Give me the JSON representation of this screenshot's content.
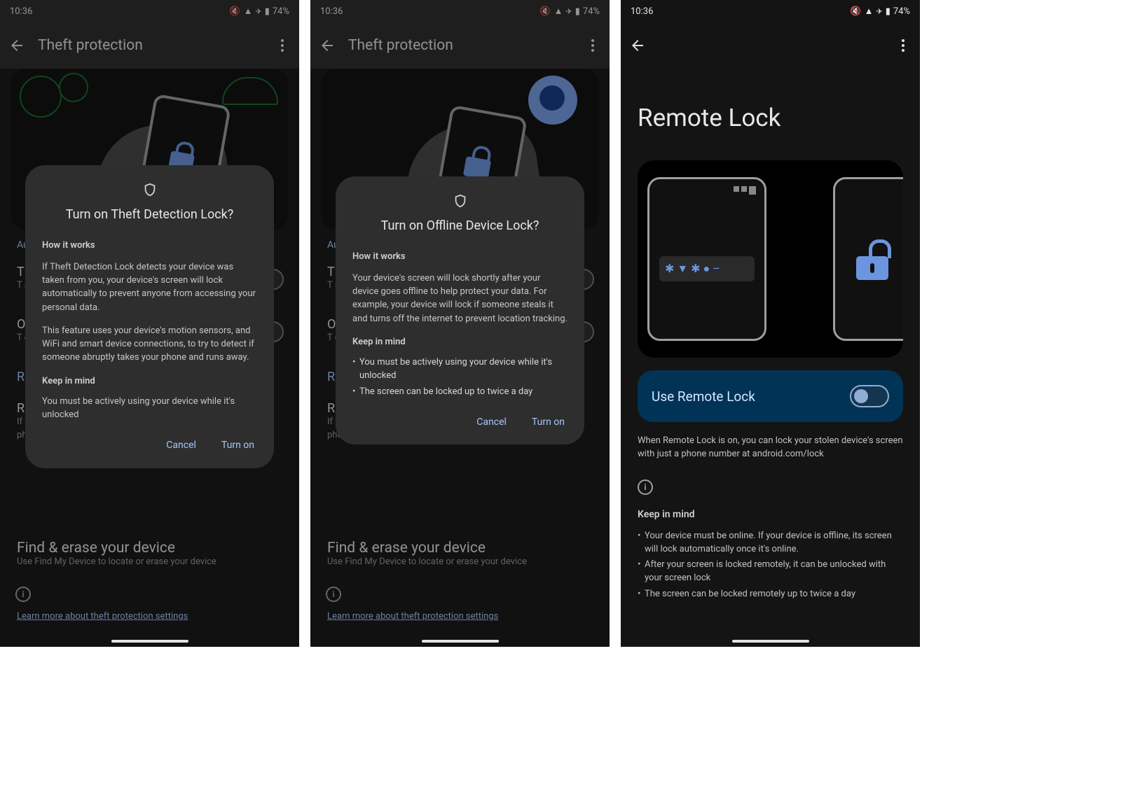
{
  "statusbar": {
    "time": "10:36",
    "battery": "74%"
  },
  "phone1": {
    "toolbar_title": "Theft protection",
    "bg_link": "Au",
    "row_t_title": "T",
    "row_t_sub": "T\nsc",
    "row_o_title": "O",
    "row_o_sub": "T\nof",
    "row_r_title": "R",
    "row_r2": "R",
    "row_r2_sub": "If y\npho",
    "find_title": "Find & erase your device",
    "find_sub": "Use Find My Device to locate or erase your device",
    "learn": "Learn more about theft protection settings",
    "dialog": {
      "title": "Turn on Theft Detection Lock?",
      "how": "How it works",
      "p1": "If Theft Detection Lock detects your device was taken from you, your device's screen will lock automatically to prevent anyone from accessing your personal data.",
      "p2": "This feature uses your device's motion sensors, and WiFi and smart device connections, to try to detect if someone abruptly takes your phone and runs away.",
      "keep": "Keep in mind",
      "k1": "You must be actively using your device while it's unlocked",
      "cancel": "Cancel",
      "turnon": "Turn on"
    }
  },
  "phone2": {
    "toolbar_title": "Theft protection",
    "bg_link": "Au",
    "row_t_title": "T",
    "row_t_sub": "T\nsc",
    "row_o_title": "O",
    "row_o_sub": "T\nof",
    "row_r_title": "R",
    "row_r2": "R",
    "row_r2_sub": "If y                                                                     a\nphone number",
    "find_title": "Find & erase your device",
    "find_sub": "Use Find My Device to locate or erase your device",
    "learn": "Learn more about theft protection settings",
    "dialog": {
      "title": "Turn on Offline Device Lock?",
      "how": "How it works",
      "p1": "Your device's screen will lock shortly after your device goes offline to help protect your data. For example, your device will lock if someone steals it and turns off the internet to prevent location tracking.",
      "keep": "Keep in mind",
      "b1": "You must be actively using your device while it's unlocked",
      "b2": "The screen can be locked up to twice a day",
      "cancel": "Cancel",
      "turnon": "Turn on"
    }
  },
  "phone3": {
    "title": "Remote Lock",
    "toggle_label": "Use Remote Lock",
    "desc": "When Remote Lock is on, you can lock your stolen device's screen with just a phone number at android.com/lock",
    "keep": "Keep in mind",
    "b1": "Your device must be online. If your device is offline, its screen will lock automatically once it's online.",
    "b2": "After your screen is locked remotely, it can be unlocked with your screen lock",
    "b3": "The screen can be locked remotely up to twice a day",
    "pwd_glyphs": "✱ ▼ ✱ ●  –"
  }
}
